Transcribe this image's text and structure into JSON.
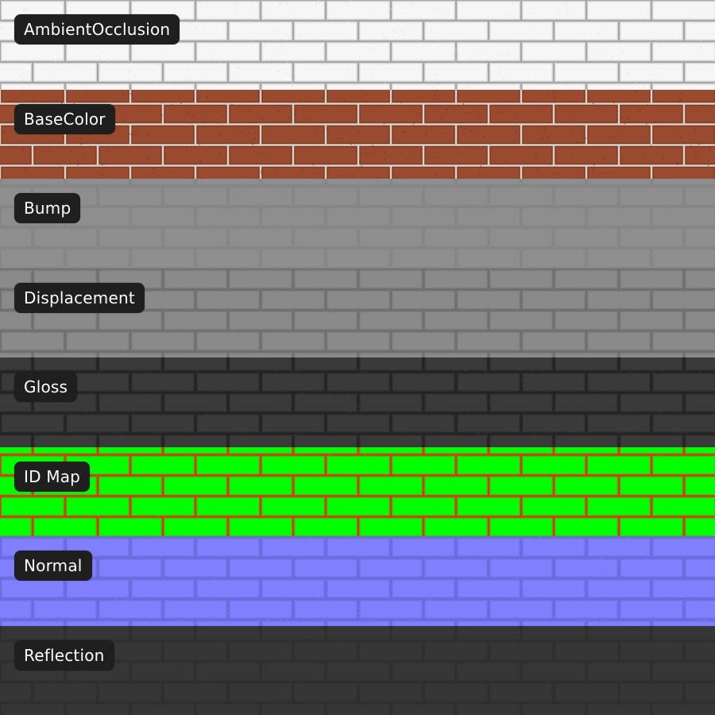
{
  "maps": [
    {
      "label": "AmbientOcclusion",
      "icon": "brick-texture-ao",
      "mortar": "#a6a6a6",
      "brick": "#f6f6f6",
      "brick_edge": "#e4e4e4",
      "noise": "#dcdcdc"
    },
    {
      "label": "BaseColor",
      "icon": "brick-texture-basecolor",
      "mortar": "#d8d2ca",
      "brick": "#9a4a2e",
      "brick_edge": "#7d3a22",
      "noise": "#6b3020"
    },
    {
      "label": "Bump",
      "icon": "brick-texture-bump",
      "mortar": "#858585",
      "brick": "#8e8e8e",
      "brick_edge": "#8a8a8a",
      "noise": "#8c8c8c"
    },
    {
      "label": "Displacement",
      "icon": "brick-texture-displacement",
      "mortar": "#6e6e6e",
      "brick": "#8a8a8a",
      "brick_edge": "#7e7e7e",
      "noise": "#858585"
    },
    {
      "label": "Gloss",
      "icon": "brick-texture-gloss",
      "mortar": "#232323",
      "brick": "#3a3a3a",
      "brick_edge": "#2e2e2e",
      "noise": "#444444"
    },
    {
      "label": "ID Map",
      "icon": "brick-texture-idmap",
      "mortar": "#e0301e",
      "brick": "#00ff00",
      "brick_edge": "#33cc00",
      "noise": "#00ee00"
    },
    {
      "label": "Normal",
      "icon": "brick-texture-normal",
      "mortar": "#6b6bd8",
      "brick": "#8080ff",
      "brick_edge": "#7272ee",
      "noise": "#8a8aff"
    },
    {
      "label": "Reflection",
      "icon": "brick-texture-reflection",
      "mortar": "#2e2e2e",
      "brick": "#363636",
      "brick_edge": "#333333",
      "noise": "#3a3a3a"
    }
  ]
}
